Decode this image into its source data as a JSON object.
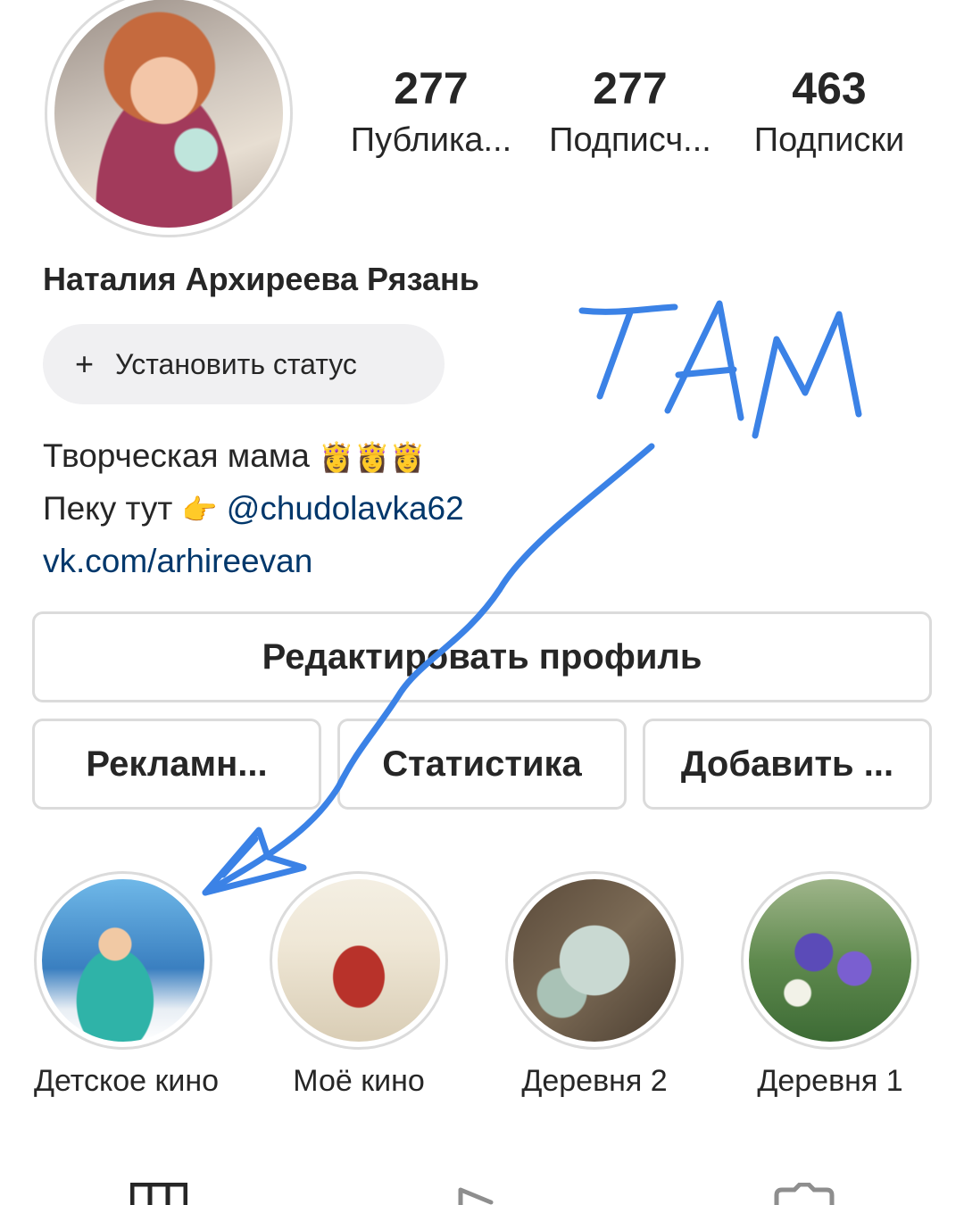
{
  "stats": [
    {
      "value": "277",
      "label": "Публика..."
    },
    {
      "value": "277",
      "label": "Подписч..."
    },
    {
      "value": "463",
      "label": "Подписки"
    }
  ],
  "profile": {
    "name": "Наталия Архиреева Рязань",
    "status_button": {
      "icon": "plus-icon",
      "label": "Установить статус"
    },
    "bio": {
      "line1": "Творческая мама",
      "line2_prefix": "Пеку тут",
      "mention": "@chudolavka62",
      "link": "vk.com/arhireevan"
    }
  },
  "buttons": {
    "edit_profile": "Редактировать профиль",
    "ads": "Рекламн...",
    "stats": "Статистика",
    "add": "Добавить ..."
  },
  "highlights": [
    {
      "label": "Детское кино"
    },
    {
      "label": "Моё кино"
    },
    {
      "label": "Деревня 2"
    },
    {
      "label": "Деревня 1"
    }
  ],
  "annotation": {
    "handwritten_text": "ТАМ",
    "color": "#3b82e6"
  },
  "tabs": [
    "grid-icon",
    "reels-icon",
    "tagged-icon"
  ]
}
